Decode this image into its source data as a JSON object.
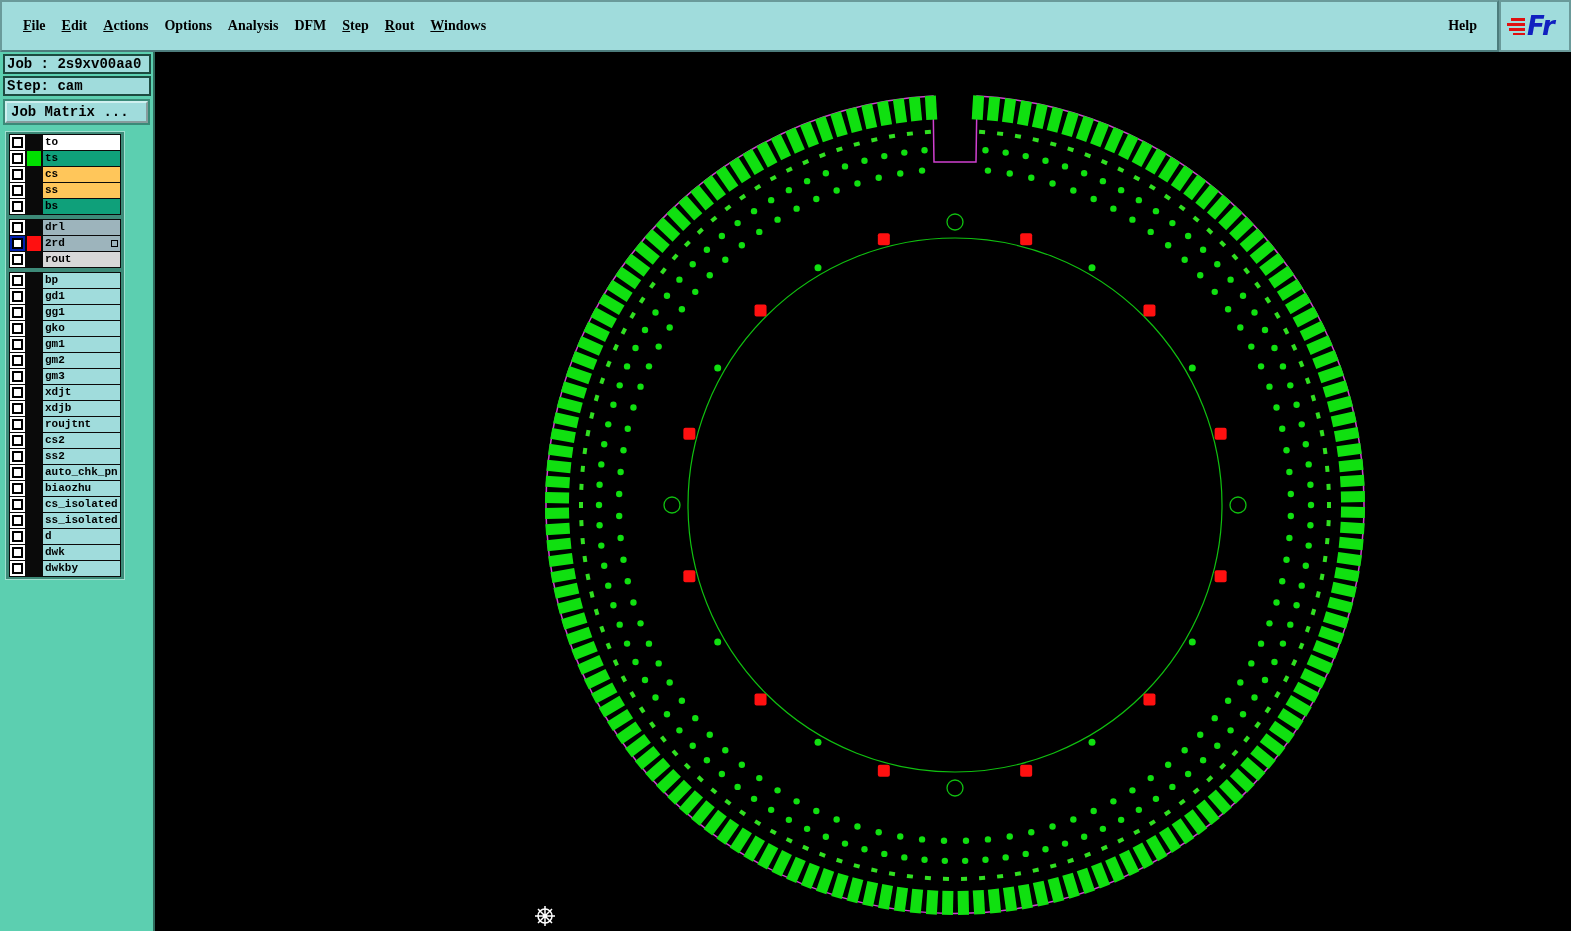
{
  "menu": [
    {
      "label": "File",
      "mnemonic": true
    },
    {
      "label": "Edit",
      "mnemonic": true
    },
    {
      "label": "Actions",
      "mnemonic": true
    },
    {
      "label": "Options",
      "mnemonic": false
    },
    {
      "label": "Analysis",
      "mnemonic": false
    },
    {
      "label": "DFM",
      "mnemonic": false
    },
    {
      "label": "Step",
      "mnemonic": true
    },
    {
      "label": "Rout",
      "mnemonic": true
    },
    {
      "label": "Windows",
      "mnemonic": true
    }
  ],
  "help": "Help",
  "logo": "Fr",
  "job": "Job : 2s9xv00aa0",
  "step": "Step: cam",
  "job_matrix_button": "Job Matrix ...",
  "layer_groups": [
    [
      {
        "name": "to",
        "kind": "silk",
        "selected": false,
        "marked": false
      },
      {
        "name": "ts",
        "kind": "mask",
        "color": "#00e000",
        "selected": false,
        "marked": false
      },
      {
        "name": "cs",
        "kind": "signal",
        "selected": false,
        "marked": false
      },
      {
        "name": "ss",
        "kind": "signal",
        "selected": false,
        "marked": false
      },
      {
        "name": "bs",
        "kind": "mask",
        "selected": false,
        "marked": false
      }
    ],
    [
      {
        "name": "drl",
        "kind": "drill",
        "selected": false,
        "marked": false
      },
      {
        "name": "2rd",
        "kind": "drill",
        "color": "#ff1010",
        "selected": true,
        "marked": true
      },
      {
        "name": "rout",
        "kind": "rout",
        "selected": false,
        "marked": false
      }
    ],
    [
      {
        "name": "bp",
        "kind": "misc",
        "selected": false,
        "marked": false
      },
      {
        "name": "gd1",
        "kind": "misc",
        "selected": false,
        "marked": false
      },
      {
        "name": "gg1",
        "kind": "misc",
        "selected": false,
        "marked": false
      },
      {
        "name": "gko",
        "kind": "misc",
        "selected": false,
        "marked": false
      },
      {
        "name": "gm1",
        "kind": "misc",
        "selected": false,
        "marked": false
      },
      {
        "name": "gm2",
        "kind": "misc",
        "selected": false,
        "marked": false
      },
      {
        "name": "gm3",
        "kind": "misc",
        "selected": false,
        "marked": false
      },
      {
        "name": "xdjt",
        "kind": "misc",
        "selected": false,
        "marked": false
      },
      {
        "name": "xdjb",
        "kind": "misc",
        "selected": false,
        "marked": false
      },
      {
        "name": "roujtnt",
        "kind": "misc",
        "selected": false,
        "marked": false
      },
      {
        "name": "cs2",
        "kind": "misc",
        "selected": false,
        "marked": false
      },
      {
        "name": "ss2",
        "kind": "misc",
        "selected": false,
        "marked": false
      },
      {
        "name": "auto_chk_pn",
        "kind": "misc",
        "selected": false,
        "marked": false
      },
      {
        "name": "biaozhu",
        "kind": "misc",
        "selected": false,
        "marked": false
      },
      {
        "name": "cs_isolated",
        "kind": "misc",
        "selected": false,
        "marked": false
      },
      {
        "name": "ss_isolated",
        "kind": "misc",
        "selected": false,
        "marked": false
      },
      {
        "name": "d",
        "kind": "misc",
        "selected": false,
        "marked": false
      },
      {
        "name": "dwk",
        "kind": "misc",
        "selected": false,
        "marked": false
      },
      {
        "name": "dwkby",
        "kind": "misc",
        "selected": false,
        "marked": false
      }
    ]
  ]
}
